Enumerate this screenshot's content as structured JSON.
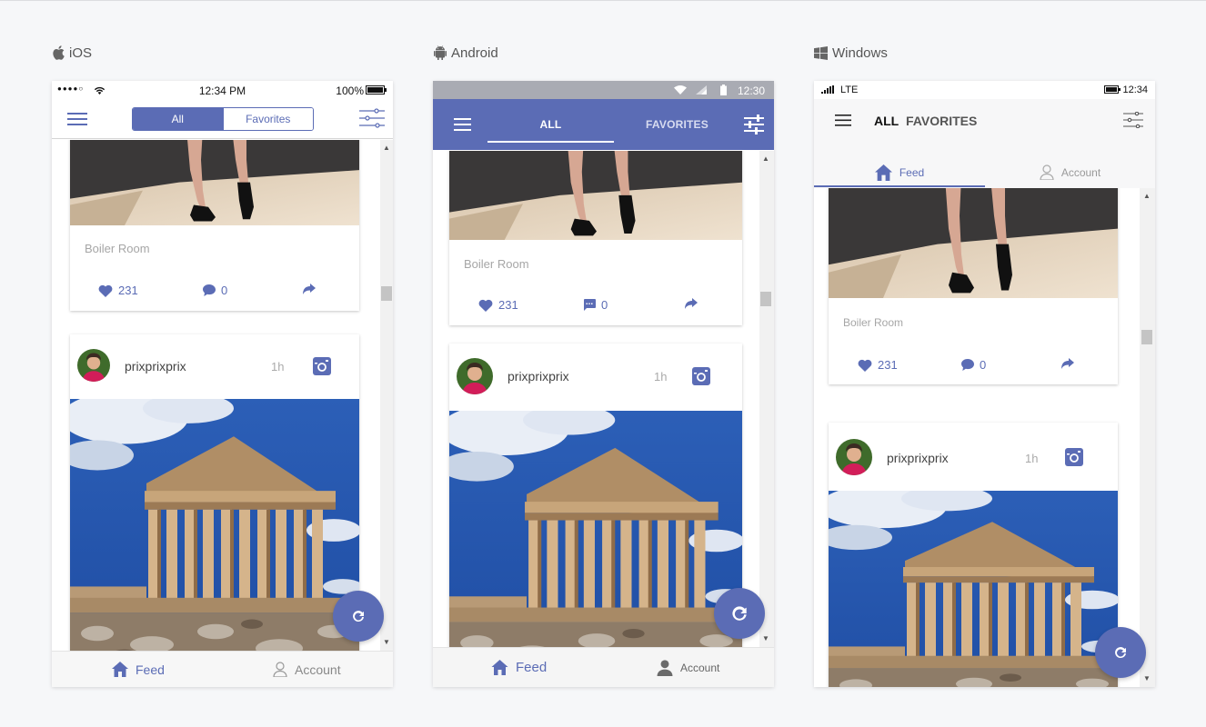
{
  "platforms": [
    {
      "name": "iOS",
      "icon": "apple-icon"
    },
    {
      "name": "Android",
      "icon": "android-icon"
    },
    {
      "name": "Windows",
      "icon": "windows-icon"
    }
  ],
  "ios": {
    "status": {
      "time": "12:34 PM",
      "battery": "100%"
    },
    "segments": [
      "All",
      "Favorites"
    ],
    "selected_segment": "All"
  },
  "android": {
    "status": {
      "time": "12:30"
    },
    "tabs": [
      "ALL",
      "FAVORITES"
    ],
    "selected_tab": "ALL"
  },
  "windows": {
    "status": {
      "network": "LTE",
      "time": "12:34"
    },
    "pivots": [
      "ALL",
      "FAVORITES"
    ],
    "selected_pivot": "ALL"
  },
  "feed": {
    "post1": {
      "location": "Boiler Room",
      "likes": "231",
      "comments": "0"
    },
    "post2": {
      "username": "prixprixprix",
      "time_ago": "1h"
    }
  },
  "bottom_nav": {
    "feed": "Feed",
    "account": "Account",
    "active": "Feed"
  },
  "colors": {
    "accent": "#5b6cb5",
    "background": "#f6f7f9",
    "android_status": "#a9abb3"
  }
}
